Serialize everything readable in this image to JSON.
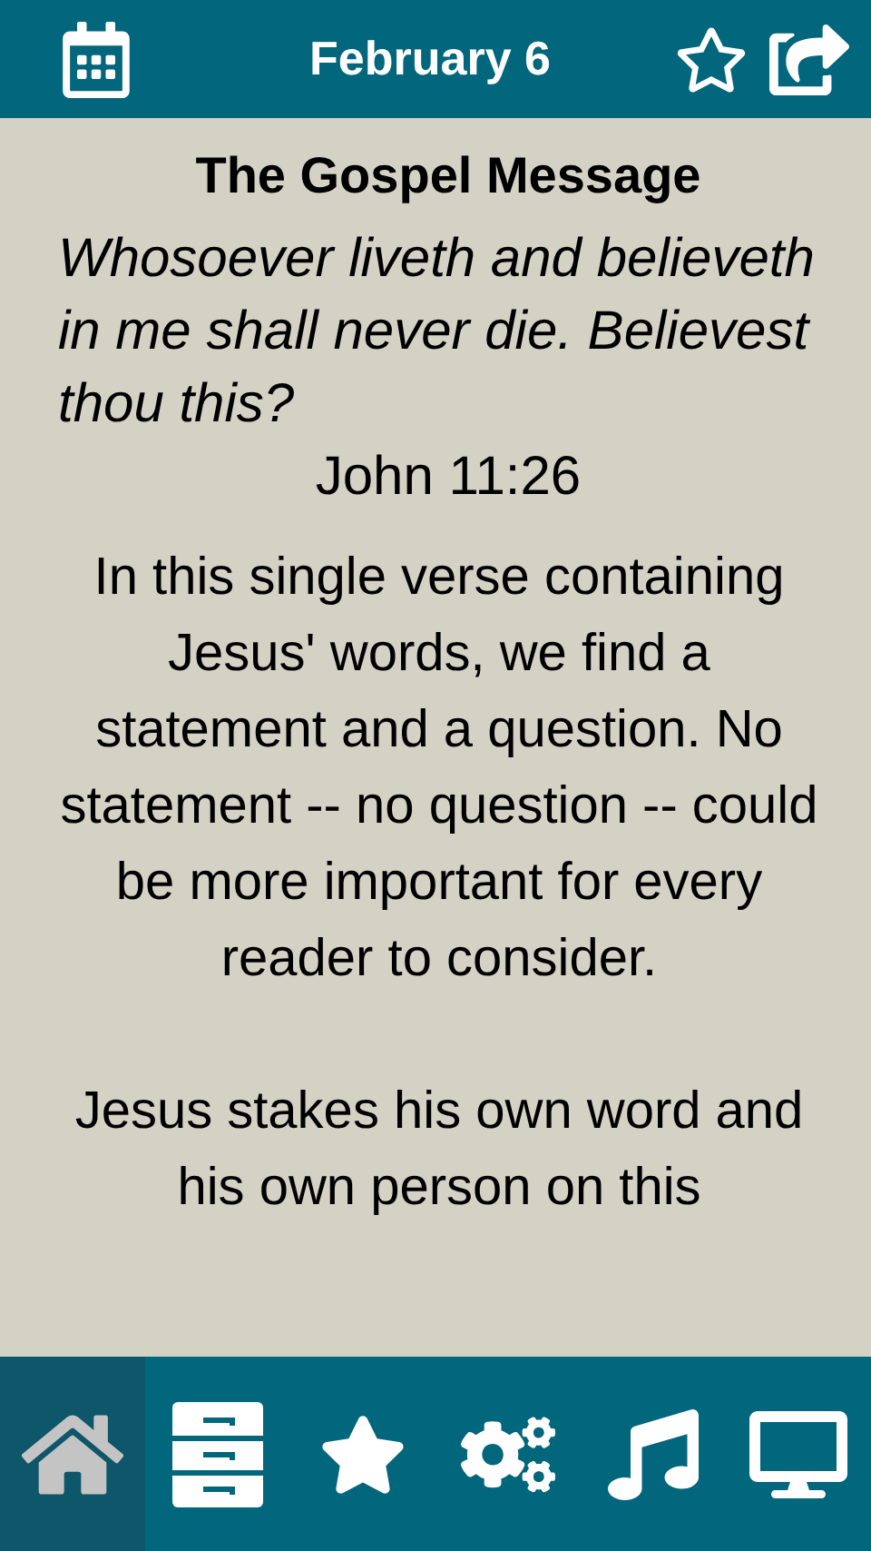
{
  "header": {
    "title": "February 6"
  },
  "article": {
    "title": "The Gospel Message",
    "verse": "Whosoever liveth and believeth in me shall never die. Believest thou this?",
    "reference": "John 11:26",
    "paragraphs": [
      "In this single verse containing Jesus' words, we find a statement and a question. No statement -- no question -- could be more important for every reader to consider.",
      "Jesus stakes his own word and his own person on this"
    ]
  },
  "tabs": [
    {
      "kind": "home",
      "selected": true
    },
    {
      "kind": "archive",
      "selected": false
    },
    {
      "kind": "favorites",
      "selected": false
    },
    {
      "kind": "settings",
      "selected": false
    },
    {
      "kind": "music",
      "selected": false
    },
    {
      "kind": "screen",
      "selected": false
    }
  ]
}
